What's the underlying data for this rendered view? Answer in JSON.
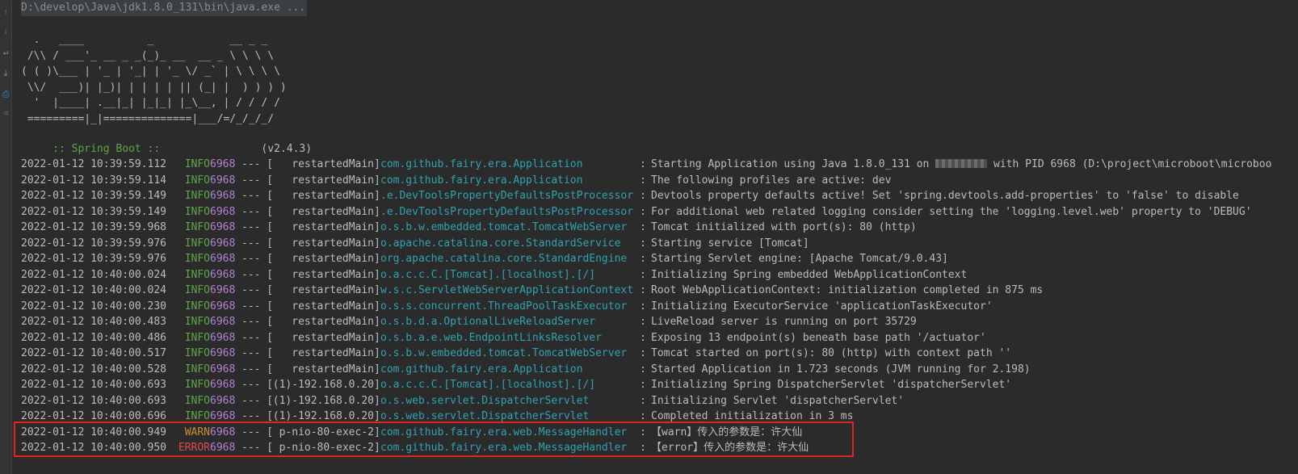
{
  "command": {
    "text": "D:\\develop\\Java\\jdk1.8.0_131\\bin\\java.exe ..."
  },
  "gutter": {
    "icons": [
      "arrow-up-icon",
      "arrow-down-icon",
      "soft-wrap-icon",
      "scroll-to-end-icon",
      "print-icon",
      "trash-icon"
    ]
  },
  "banner": {
    "ascii_art": "  .   ____          _            __ _ _\n /\\\\ / ___'_ __ _ _(_)_ __  __ _ \\ \\ \\ \\\n( ( )\\___ | '_ | '_| | '_ \\/ _` | \\ \\ \\ \\\n \\\\/  ___)| |_)| | | | | || (_| |  ) ) ) )\n  '  |____| .__|_| |_|_| |_\\__, | / / / /\n =========|_|==============|___/=/_/_/_/",
    "boot_label": " :: Spring Boot :: ",
    "boot_version": "               (v2.4.3)"
  },
  "colors": {
    "background": "#2b2b2b",
    "text": "#bbbbbb",
    "info": "#5ea545",
    "warn": "#cc8d31",
    "error": "#e04a4a",
    "pid": "#b480d6",
    "logger": "#2fa2b1",
    "highlight": "#e02525"
  },
  "logs": [
    {
      "ts": "2022-01-12 10:39:59.112",
      "level": "INFO",
      "pid": "6968",
      "sep": "--- [",
      "thread": "restartedMain",
      "close": "]",
      "logger": "com.github.fairy.era.Application",
      "colon": ":",
      "msg": "Starting Application using Java 1.8.0_131 on",
      "msg_after": " with PID 6968 (D:\\project\\microboot\\microboo",
      "redacted": true
    },
    {
      "ts": "2022-01-12 10:39:59.114",
      "level": "INFO",
      "pid": "6968",
      "sep": "--- [",
      "thread": "restartedMain",
      "close": "]",
      "logger": "com.github.fairy.era.Application",
      "colon": ":",
      "msg": "The following profiles are active: dev"
    },
    {
      "ts": "2022-01-12 10:39:59.149",
      "level": "INFO",
      "pid": "6968",
      "sep": "--- [",
      "thread": "restartedMain",
      "close": "]",
      "logger": ".e.DevToolsPropertyDefaultsPostProcessor",
      "colon": ":",
      "msg": "Devtools property defaults active! Set 'spring.devtools.add-properties' to 'false' to disable"
    },
    {
      "ts": "2022-01-12 10:39:59.149",
      "level": "INFO",
      "pid": "6968",
      "sep": "--- [",
      "thread": "restartedMain",
      "close": "]",
      "logger": ".e.DevToolsPropertyDefaultsPostProcessor",
      "colon": ":",
      "msg": "For additional web related logging consider setting the 'logging.level.web' property to 'DEBUG'"
    },
    {
      "ts": "2022-01-12 10:39:59.968",
      "level": "INFO",
      "pid": "6968",
      "sep": "--- [",
      "thread": "restartedMain",
      "close": "]",
      "logger": "o.s.b.w.embedded.tomcat.TomcatWebServer",
      "colon": ":",
      "msg": "Tomcat initialized with port(s): 80 (http)"
    },
    {
      "ts": "2022-01-12 10:39:59.976",
      "level": "INFO",
      "pid": "6968",
      "sep": "--- [",
      "thread": "restartedMain",
      "close": "]",
      "logger": "o.apache.catalina.core.StandardService",
      "colon": ":",
      "msg": "Starting service [Tomcat]"
    },
    {
      "ts": "2022-01-12 10:39:59.976",
      "level": "INFO",
      "pid": "6968",
      "sep": "--- [",
      "thread": "restartedMain",
      "close": "]",
      "logger": "org.apache.catalina.core.StandardEngine",
      "colon": ":",
      "msg": "Starting Servlet engine: [Apache Tomcat/9.0.43]"
    },
    {
      "ts": "2022-01-12 10:40:00.024",
      "level": "INFO",
      "pid": "6968",
      "sep": "--- [",
      "thread": "restartedMain",
      "close": "]",
      "logger": "o.a.c.c.C.[Tomcat].[localhost].[/]",
      "colon": ":",
      "msg": "Initializing Spring embedded WebApplicationContext"
    },
    {
      "ts": "2022-01-12 10:40:00.024",
      "level": "INFO",
      "pid": "6968",
      "sep": "--- [",
      "thread": "restartedMain",
      "close": "]",
      "logger": "w.s.c.ServletWebServerApplicationContext",
      "colon": ":",
      "msg": "Root WebApplicationContext: initialization completed in 875 ms"
    },
    {
      "ts": "2022-01-12 10:40:00.230",
      "level": "INFO",
      "pid": "6968",
      "sep": "--- [",
      "thread": "restartedMain",
      "close": "]",
      "logger": "o.s.s.concurrent.ThreadPoolTaskExecutor",
      "colon": ":",
      "msg": "Initializing ExecutorService 'applicationTaskExecutor'"
    },
    {
      "ts": "2022-01-12 10:40:00.483",
      "level": "INFO",
      "pid": "6968",
      "sep": "--- [",
      "thread": "restartedMain",
      "close": "]",
      "logger": "o.s.b.d.a.OptionalLiveReloadServer",
      "colon": ":",
      "msg": "LiveReload server is running on port 35729"
    },
    {
      "ts": "2022-01-12 10:40:00.486",
      "level": "INFO",
      "pid": "6968",
      "sep": "--- [",
      "thread": "restartedMain",
      "close": "]",
      "logger": "o.s.b.a.e.web.EndpointLinksResolver",
      "colon": ":",
      "msg": "Exposing 13 endpoint(s) beneath base path '/actuator'"
    },
    {
      "ts": "2022-01-12 10:40:00.517",
      "level": "INFO",
      "pid": "6968",
      "sep": "--- [",
      "thread": "restartedMain",
      "close": "]",
      "logger": "o.s.b.w.embedded.tomcat.TomcatWebServer",
      "colon": ":",
      "msg": "Tomcat started on port(s): 80 (http) with context path ''"
    },
    {
      "ts": "2022-01-12 10:40:00.528",
      "level": "INFO",
      "pid": "6968",
      "sep": "--- [",
      "thread": "restartedMain",
      "close": "]",
      "logger": "com.github.fairy.era.Application",
      "colon": ":",
      "msg": "Started Application in 1.723 seconds (JVM running for 2.198)"
    },
    {
      "ts": "2022-01-12 10:40:00.693",
      "level": "INFO",
      "pid": "6968",
      "sep": "--- [",
      "thread": "(1)-192.168.0.20",
      "close": "]",
      "logger": "o.a.c.c.C.[Tomcat].[localhost].[/]",
      "colon": ":",
      "msg": "Initializing Spring DispatcherServlet 'dispatcherServlet'"
    },
    {
      "ts": "2022-01-12 10:40:00.693",
      "level": "INFO",
      "pid": "6968",
      "sep": "--- [",
      "thread": "(1)-192.168.0.20",
      "close": "]",
      "logger": "o.s.web.servlet.DispatcherServlet",
      "colon": ":",
      "msg": "Initializing Servlet 'dispatcherServlet'"
    },
    {
      "ts": "2022-01-12 10:40:00.696",
      "level": "INFO",
      "pid": "6968",
      "sep": "--- [",
      "thread": "(1)-192.168.0.20",
      "close": "]",
      "logger": "o.s.web.servlet.DispatcherServlet",
      "colon": ":",
      "msg": "Completed initialization in 3 ms"
    },
    {
      "ts": "2022-01-12 10:40:00.949",
      "level": "WARN",
      "pid": "6968",
      "sep": "--- [",
      "thread": "p-nio-80-exec-2",
      "close": "]",
      "logger": "com.github.fairy.era.web.MessageHandler",
      "colon": ":",
      "msg": "【warn】传入的参数是：许大仙"
    },
    {
      "ts": "2022-01-12 10:40:00.950",
      "level": "ERROR",
      "pid": "6968",
      "sep": "--- [",
      "thread": "p-nio-80-exec-2",
      "close": "]",
      "logger": "com.github.fairy.era.web.MessageHandler",
      "colon": ":",
      "msg": "【error】传入的参数是：许大仙"
    }
  ]
}
